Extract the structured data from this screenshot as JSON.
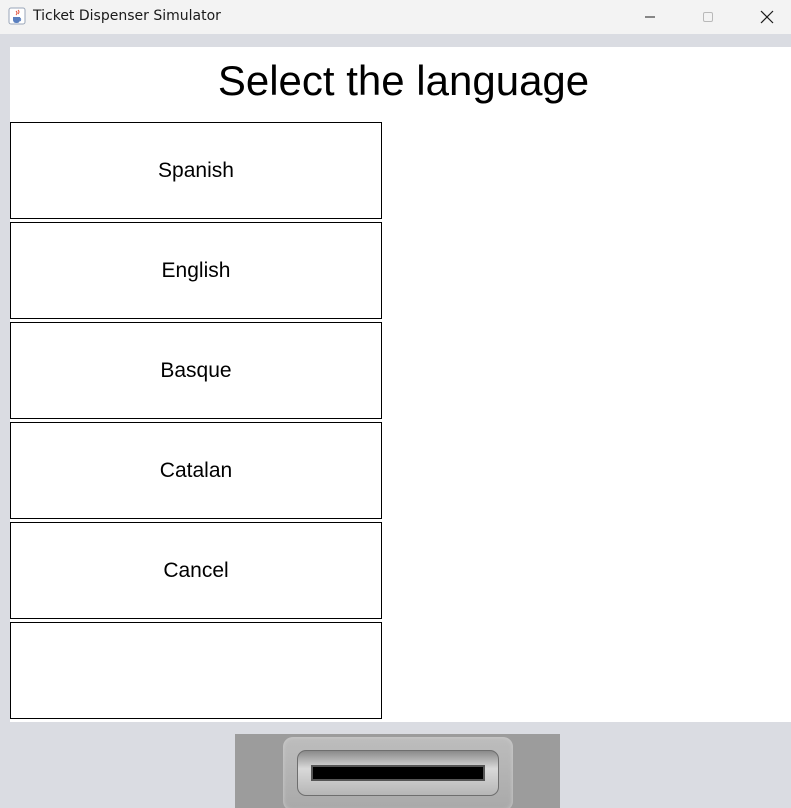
{
  "window": {
    "title": "Ticket Dispenser Simulator"
  },
  "main": {
    "heading": "Select the language",
    "buttons": [
      {
        "label": "Spanish"
      },
      {
        "label": "English"
      },
      {
        "label": "Basque"
      },
      {
        "label": "Catalan"
      },
      {
        "label": "Cancel"
      },
      {
        "label": ""
      }
    ]
  },
  "icons": {
    "app": "java-cup-icon",
    "minimize": "minimize-icon",
    "maximize": "maximize-icon",
    "close": "close-icon"
  },
  "colors": {
    "frame_background": "#dadce2",
    "content_background": "#ffffff",
    "button_border": "#000000",
    "dispenser_background": "#9c9c9c"
  }
}
